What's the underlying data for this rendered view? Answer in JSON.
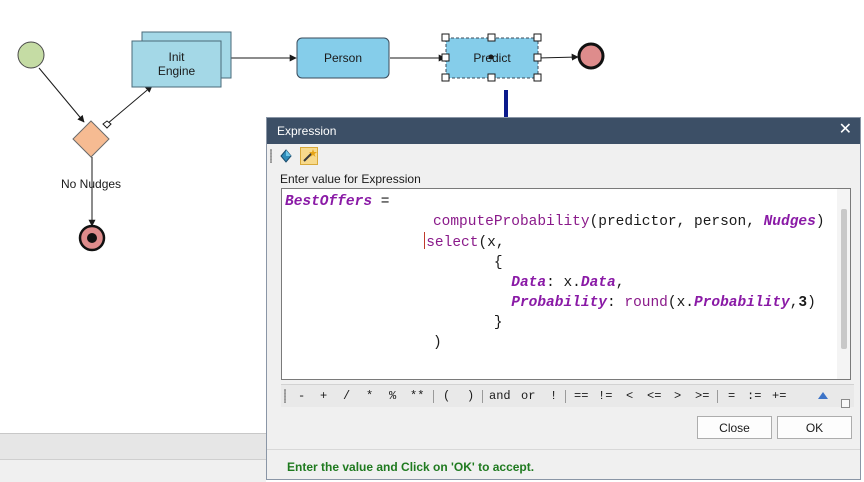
{
  "diagram": {
    "nodes": {
      "init_engine": "Init\nEngine",
      "person": "Person",
      "predict": "Predict"
    },
    "labels": {
      "no_nudges": "No Nudges"
    },
    "colors": {
      "start_fill": "#c5dca4",
      "end_fill": "#de8c8c",
      "gateway_fill": "#f6bb92",
      "task_fill": "#85cdea",
      "init_fill": "#a4d8e7",
      "arrow_blue": "#0b1a8c"
    }
  },
  "dialog": {
    "title": "Expression",
    "close_glyph": "✕",
    "prompt": "Enter value for Expression",
    "code": {
      "line1_name": "BestOffers",
      "line1_eq": " =",
      "line2_fn": "computeProbability",
      "line2_args_a": "(predictor, person, ",
      "line2_nudges": "Nudges",
      "line2_close": ")",
      "line3_fn": "select",
      "line3_rest": "(x,",
      "line4": "{",
      "line5_key": "Data",
      "line5_mid": ": x.",
      "line5_val": "Data",
      "line5_end": ",",
      "line6_key": "Probability",
      "line6_mid": ": ",
      "line6_fn": "round",
      "line6_x": "(x.",
      "line6_val": "Probability",
      "line6_comma": ",",
      "line6_num": "3",
      "line6_end": ")",
      "line7": "}",
      "line8": ")"
    },
    "operators": [
      "-",
      "+",
      "/",
      "*",
      "%",
      "**",
      "(",
      ")",
      "and",
      "or",
      "!",
      "==",
      "!=",
      "<",
      "<=",
      ">",
      ">=",
      "=",
      ":=",
      "+="
    ],
    "buttons": {
      "close": "Close",
      "ok": "OK"
    },
    "status": "Enter the value and Click on 'OK' to accept."
  }
}
